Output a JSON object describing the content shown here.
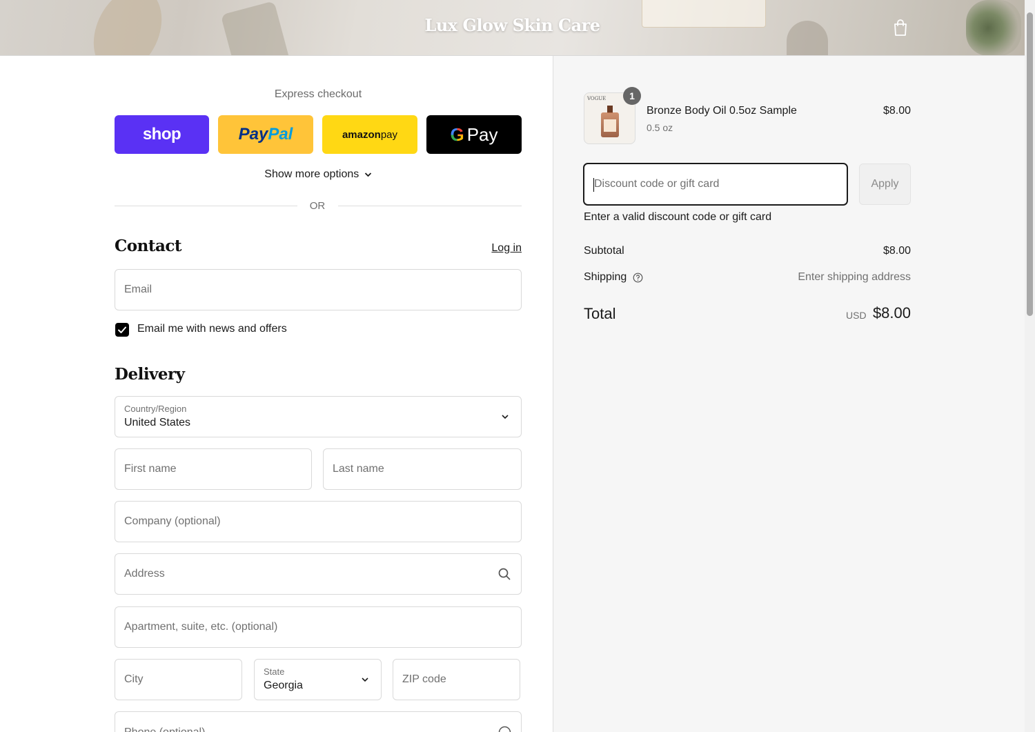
{
  "header": {
    "brand": "Lux Glow Skin Care",
    "cart_icon": "shopping-bag-icon"
  },
  "express": {
    "title": "Express checkout",
    "buttons": [
      {
        "name": "shop-pay-button",
        "label": "shop",
        "color": "#5a31f4"
      },
      {
        "name": "paypal-button",
        "label_a": "Pay",
        "label_b": "Pal",
        "color": "#ffc439"
      },
      {
        "name": "amazon-pay-button",
        "label_a": "amazon",
        "label_b": " pay",
        "color": "#ffd814"
      },
      {
        "name": "google-pay-button",
        "label_a": "G",
        "label_b": "Pay",
        "color": "#000000"
      }
    ],
    "more_options": "Show more options",
    "or": "OR"
  },
  "contact": {
    "title": "Contact",
    "login": "Log in",
    "email_placeholder": "Email",
    "newsletter_label": "Email me with news and offers",
    "newsletter_checked": true
  },
  "delivery": {
    "title": "Delivery",
    "country_label": "Country/Region",
    "country_value": "United States",
    "first_name": "First name",
    "last_name": "Last name",
    "company": "Company (optional)",
    "address": "Address",
    "apartment": "Apartment, suite, etc. (optional)",
    "city": "City",
    "state_label": "State",
    "state_value": "Georgia",
    "zip": "ZIP code",
    "phone": "Phone (optional)"
  },
  "summary": {
    "item": {
      "quantity": "1",
      "name": "Bronze Body Oil 0.5oz Sample",
      "variant": "0.5 oz",
      "price": "$8.00",
      "thumb_text": "VOGUE"
    },
    "discount_placeholder": "Discount code or gift card",
    "apply": "Apply",
    "discount_error": "Enter a valid discount code or gift card",
    "subtotal_label": "Subtotal",
    "subtotal_value": "$8.00",
    "shipping_label": "Shipping",
    "shipping_value": "Enter shipping address",
    "total_label": "Total",
    "total_currency": "USD",
    "total_value": "$8.00"
  }
}
